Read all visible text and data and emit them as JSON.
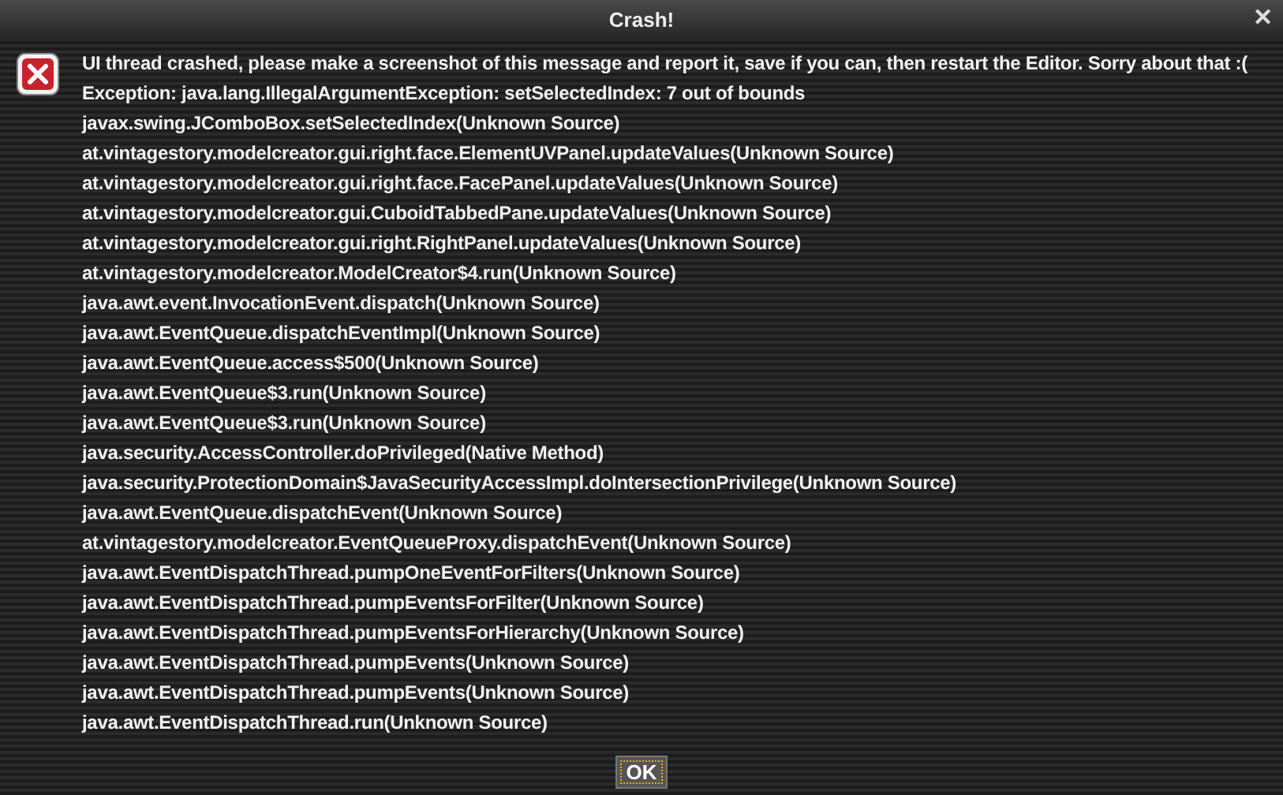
{
  "window": {
    "title": "Crash!",
    "close": "✕"
  },
  "message": "UI thread crashed, please make a screenshot of this message and report it, save if you can, then restart the Editor. Sorry about that :(",
  "stack_trace": [
    "Exception: java.lang.IllegalArgumentException: setSelectedIndex: 7 out of bounds",
    "javax.swing.JComboBox.setSelectedIndex(Unknown Source)",
    "at.vintagestory.modelcreator.gui.right.face.ElementUVPanel.updateValues(Unknown Source)",
    "at.vintagestory.modelcreator.gui.right.face.FacePanel.updateValues(Unknown Source)",
    "at.vintagestory.modelcreator.gui.CuboidTabbedPane.updateValues(Unknown Source)",
    "at.vintagestory.modelcreator.gui.right.RightPanel.updateValues(Unknown Source)",
    "at.vintagestory.modelcreator.ModelCreator$4.run(Unknown Source)",
    "java.awt.event.InvocationEvent.dispatch(Unknown Source)",
    "java.awt.EventQueue.dispatchEventImpl(Unknown Source)",
    "java.awt.EventQueue.access$500(Unknown Source)",
    "java.awt.EventQueue$3.run(Unknown Source)",
    "java.awt.EventQueue$3.run(Unknown Source)",
    "java.security.AccessController.doPrivileged(Native Method)",
    "java.security.ProtectionDomain$JavaSecurityAccessImpl.doIntersectionPrivilege(Unknown Source)",
    "java.awt.EventQueue.dispatchEvent(Unknown Source)",
    "at.vintagestory.modelcreator.EventQueueProxy.dispatchEvent(Unknown Source)",
    "java.awt.EventDispatchThread.pumpOneEventForFilters(Unknown Source)",
    "java.awt.EventDispatchThread.pumpEventsForFilter(Unknown Source)",
    "java.awt.EventDispatchThread.pumpEventsForHierarchy(Unknown Source)",
    "java.awt.EventDispatchThread.pumpEvents(Unknown Source)",
    "java.awt.EventDispatchThread.pumpEvents(Unknown Source)",
    "java.awt.EventDispatchThread.run(Unknown Source)"
  ],
  "buttons": [
    {
      "label": "OK",
      "focused": true
    }
  ]
}
